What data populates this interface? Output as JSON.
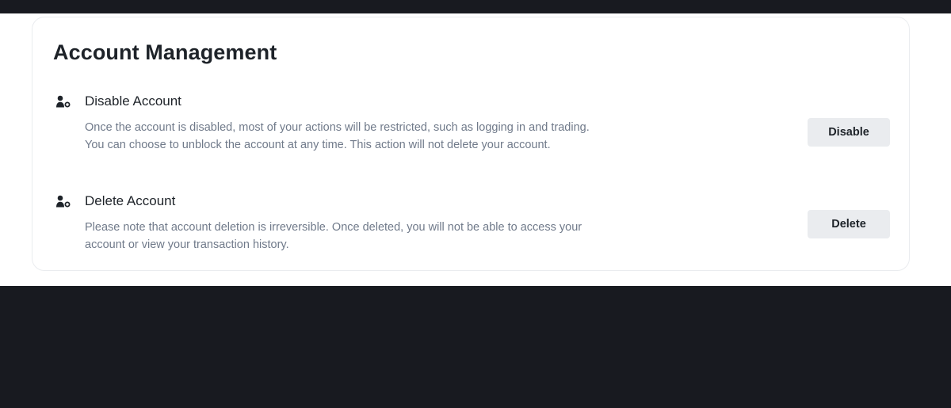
{
  "card": {
    "title": "Account Management"
  },
  "sections": [
    {
      "icon": "user-settings-icon",
      "title": "Disable Account",
      "description": "Once the account is disabled, most of your actions will be restricted, such as logging in and trading. You can choose to unblock the account at any time. This action will not delete your account.",
      "button_label": "Disable"
    },
    {
      "icon": "user-settings-icon",
      "title": "Delete Account",
      "description": "Please note that account deletion is irreversible. Once deleted, you will not be able to access your account or view your transaction history.",
      "button_label": "Delete"
    }
  ],
  "colors": {
    "background": "#181a20",
    "panel": "#ffffff",
    "title_text": "#1e2329",
    "body_text": "#707a8a",
    "button_bg": "#eaecef",
    "card_border": "#eaecef"
  }
}
